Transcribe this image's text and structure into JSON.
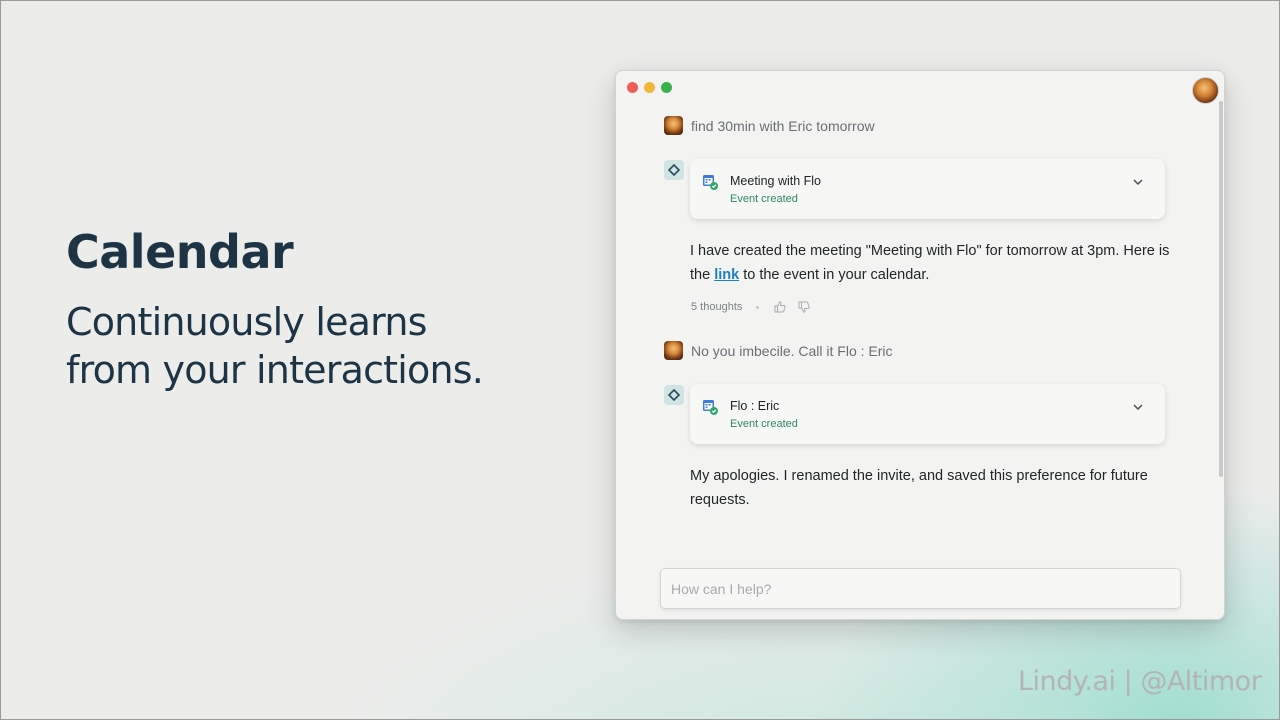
{
  "slide": {
    "heading": "Calendar",
    "subheading": "Continuously learns from your interactions.",
    "watermark": "Lindy.ai | @Altimor"
  },
  "window": {
    "controls": [
      "close",
      "minimize",
      "maximize"
    ],
    "messages": [
      {
        "role": "user",
        "text": "find 30min with Eric tomorrow"
      },
      {
        "role": "assistant",
        "card": {
          "title": "Meeting with Flo",
          "status": "Event created",
          "icon": "calendar-check-icon"
        },
        "text_before_link": "I have created the meeting \"Meeting with Flo\" for tomorrow at 3pm. Here is the ",
        "link_text": "link",
        "text_after_link": " to the event in your calendar.",
        "thoughts": "5 thoughts"
      },
      {
        "role": "user",
        "text": "No you imbecile. Call it Flo : Eric"
      },
      {
        "role": "assistant",
        "card": {
          "title": "Flo : Eric",
          "status": "Event created",
          "icon": "calendar-check-icon"
        },
        "text": "My apologies. I renamed the invite, and saved this preference for future requests."
      }
    ],
    "input": {
      "placeholder": "How can I help?",
      "value": ""
    }
  },
  "colors": {
    "heading": "#1e3445",
    "status_green": "#2e8a5e",
    "link": "#1f7fc4",
    "close": "#ee5e55",
    "minimize": "#f0b638",
    "maximize": "#37b24a",
    "accent_glow": "#96dccd"
  }
}
